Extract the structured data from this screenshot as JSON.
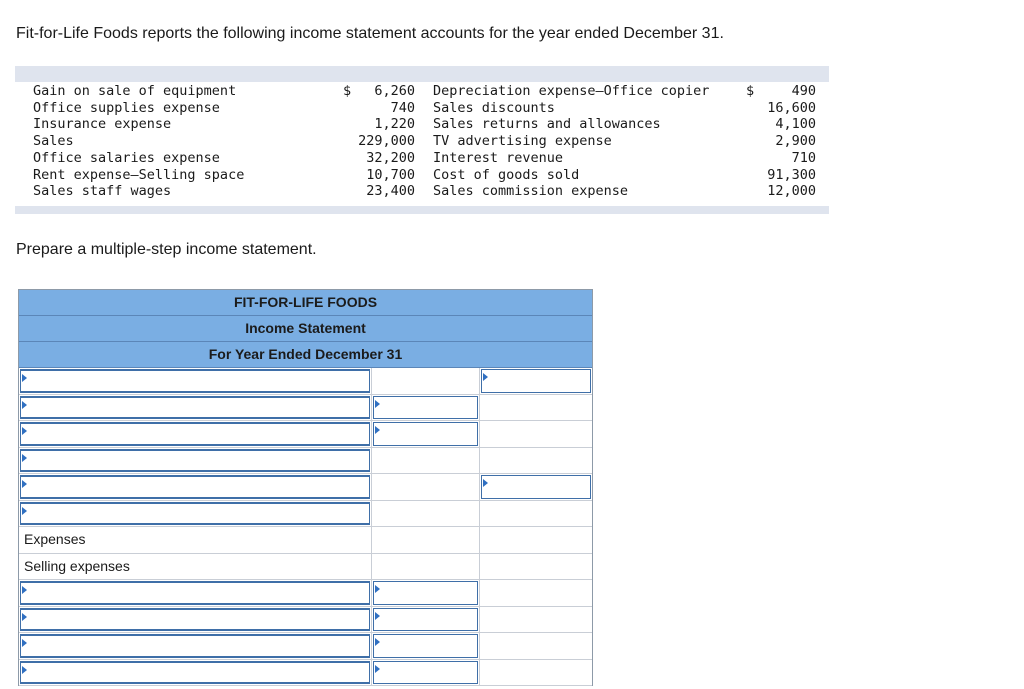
{
  "prompt": "Fit-for-Life Foods reports the following income statement accounts for the year ended December 31.",
  "accounts": [
    {
      "left_name": "Gain on sale of equipment",
      "left_currency": "$",
      "left_amount": "6,260",
      "right_name": "Depreciation expense—Office copier",
      "right_currency": "$",
      "right_amount": "490"
    },
    {
      "left_name": "Office supplies expense",
      "left_currency": "",
      "left_amount": "740",
      "right_name": "Sales discounts",
      "right_currency": "",
      "right_amount": "16,600"
    },
    {
      "left_name": "Insurance expense",
      "left_currency": "",
      "left_amount": "1,220",
      "right_name": "Sales returns and allowances",
      "right_currency": "",
      "right_amount": "4,100"
    },
    {
      "left_name": "Sales",
      "left_currency": "",
      "left_amount": "229,000",
      "right_name": "TV advertising expense",
      "right_currency": "",
      "right_amount": "2,900"
    },
    {
      "left_name": "Office salaries expense",
      "left_currency": "",
      "left_amount": "32,200",
      "right_name": "Interest revenue",
      "right_currency": "",
      "right_amount": "710"
    },
    {
      "left_name": "Rent expense—Selling space",
      "left_currency": "",
      "left_amount": "10,700",
      "right_name": "Cost of goods sold",
      "right_currency": "",
      "right_amount": "91,300"
    },
    {
      "left_name": "Sales staff wages",
      "left_currency": "",
      "left_amount": "23,400",
      "right_name": "Sales commission expense",
      "right_currency": "",
      "right_amount": "12,000"
    }
  ],
  "instruction": "Prepare a multiple-step income statement.",
  "statement": {
    "company": "FIT-FOR-LIFE FOODS",
    "title": "Income Statement",
    "period": "For Year Ended December 31",
    "rows": [
      {
        "label": "",
        "a": true,
        "b": false,
        "c": true
      },
      {
        "label": "",
        "a": true,
        "b": true,
        "c": false
      },
      {
        "label": "",
        "a": true,
        "b": true,
        "c": false
      },
      {
        "label": "",
        "a": true,
        "b": false,
        "c": false
      },
      {
        "label": "",
        "a": true,
        "b": false,
        "c": true
      },
      {
        "label": "",
        "a": true,
        "b": false,
        "c": false
      },
      {
        "label": "Expenses",
        "a": false,
        "b": false,
        "c": false
      },
      {
        "label": "Selling expenses",
        "a": false,
        "b": false,
        "c": false
      },
      {
        "label": "",
        "a": true,
        "b": true,
        "c": false
      },
      {
        "label": "",
        "a": true,
        "b": true,
        "c": false
      },
      {
        "label": "",
        "a": true,
        "b": true,
        "c": false
      },
      {
        "label": "",
        "a": true,
        "b": true,
        "c": false
      }
    ]
  }
}
